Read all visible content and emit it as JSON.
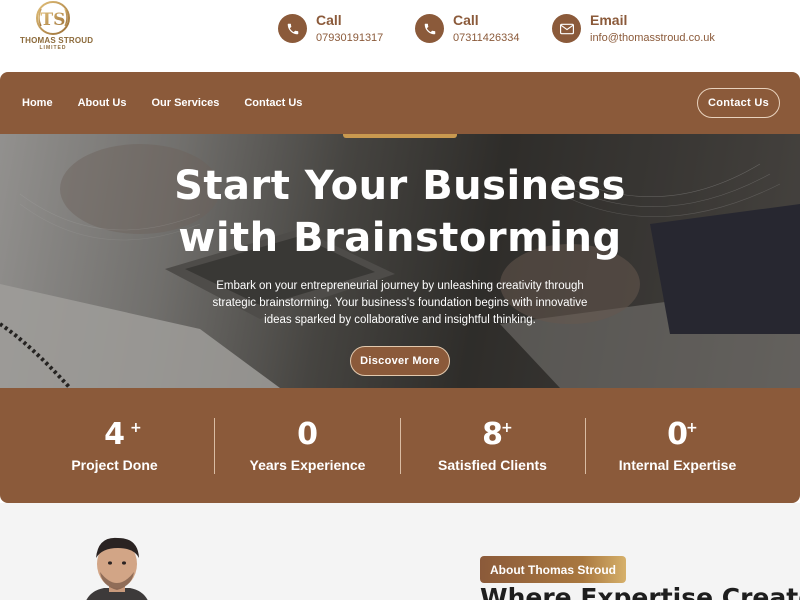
{
  "brand": {
    "name": "THOMAS STROUD",
    "sub": "LIMITED",
    "monogram": "TS",
    "logo_icon": "laurel-monogram-icon"
  },
  "contacts": [
    {
      "title": "Call",
      "value": "07930191317",
      "icon": "phone-icon"
    },
    {
      "title": "Call",
      "value": "07311426334",
      "icon": "phone-icon"
    },
    {
      "title": "Email",
      "value": "info@thomasstroud.co.uk",
      "icon": "envelope-icon"
    }
  ],
  "nav": {
    "links": [
      "Home",
      "About Us",
      "Our Services",
      "Contact Us"
    ],
    "cta": "Contact Us"
  },
  "hero": {
    "title_line1": "Start Your Business",
    "title_line2": "with Brainstorming",
    "text": "Embark on your entrepreneurial journey by unleashing creativity through strategic brainstorming. Your business's foundation begins with innovative ideas sparked by collaborative and insightful thinking.",
    "button": "Discover More"
  },
  "stats": [
    {
      "value": "4",
      "suffix": "+",
      "label": "Project Done"
    },
    {
      "value": "0",
      "suffix": "",
      "label": "Years Experience"
    },
    {
      "value": "8",
      "suffix": "+",
      "label": "Satisfied Clients"
    },
    {
      "value": "0",
      "suffix": "+",
      "label": "Internal Expertise"
    }
  ],
  "about": {
    "badge": "About Thomas Stroud",
    "heading": "Where Expertise Creates"
  },
  "colors": {
    "brand_brown": "#8b5a3a",
    "gold": "#c9994f",
    "page_bg": "#ffffff",
    "section_bg": "#f4f4f4"
  }
}
